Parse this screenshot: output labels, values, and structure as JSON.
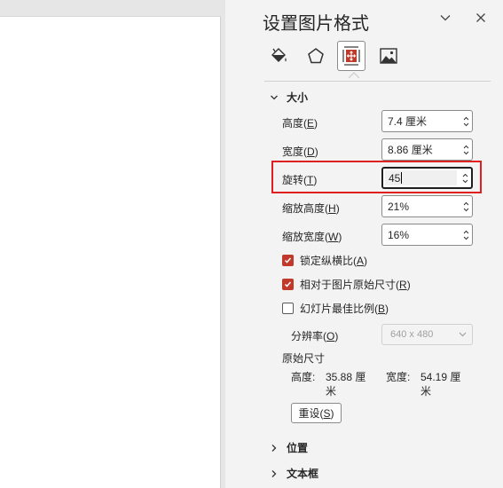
{
  "pane": {
    "title": "设置图片格式",
    "collapse_icon": "chevron-down-icon",
    "close_icon": "close-icon",
    "tabs": [
      {
        "icon": "fill-line-icon",
        "active": false
      },
      {
        "icon": "effects-pentagon-icon",
        "active": false
      },
      {
        "icon": "size-properties-icon",
        "active": true
      },
      {
        "icon": "picture-icon",
        "active": false
      }
    ]
  },
  "size_section": {
    "header": "大小",
    "height": {
      "label": "高度",
      "key": "E",
      "value": "7.4 厘米"
    },
    "width": {
      "label": "宽度",
      "key": "D",
      "value": "8.86 厘米"
    },
    "rotation": {
      "label": "旋转",
      "key": "T",
      "value": "45"
    },
    "scale_height": {
      "label": "缩放高度",
      "key": "H",
      "value": "21%"
    },
    "scale_width": {
      "label": "缩放宽度",
      "key": "W",
      "value": "16%"
    },
    "lock_aspect": {
      "label": "锁定纵横比",
      "key": "A",
      "checked": true
    },
    "relative_original": {
      "label": "相对于图片原始尺寸",
      "key": "R",
      "checked": true
    },
    "best_scale": {
      "label": "幻灯片最佳比例",
      "key": "B",
      "checked": false
    },
    "resolution": {
      "label": "分辨率",
      "key": "O",
      "value": "640 x 480"
    },
    "original_size": {
      "title": "原始尺寸",
      "height_label": "高度:",
      "height_value": "35.88 厘",
      "height_unit": "米",
      "width_label": "宽度:",
      "width_value": "54.19 厘",
      "width_unit": "米"
    },
    "reset": {
      "label": "重设",
      "key": "S"
    }
  },
  "position_section": {
    "header": "位置"
  },
  "textbox_section": {
    "header": "文本框"
  },
  "colors": {
    "accent": "#c0392b",
    "highlight": "#e02020",
    "pane_bg": "#f3f3f3"
  }
}
